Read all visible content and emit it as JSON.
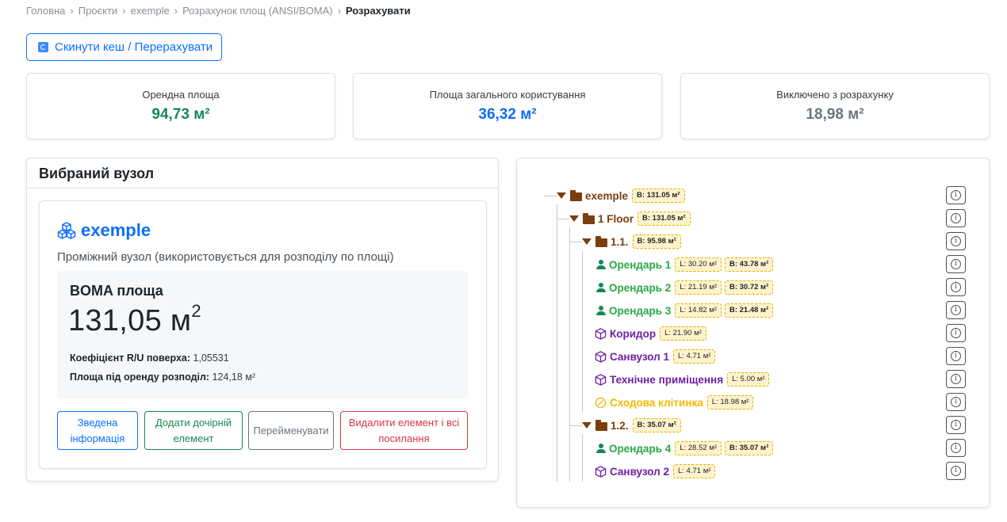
{
  "breadcrumb": {
    "items": [
      "Головна",
      "Проєкти",
      "exemple",
      "Розрахунок площ (ANSI/BOMA)"
    ],
    "current": "Розрахувати",
    "separator": "›"
  },
  "toolbar": {
    "reset_label": "Скинути кеш / Перерахувати"
  },
  "stats": [
    {
      "label": "Орендна площа",
      "value": "94,73 м²",
      "color": "#198754"
    },
    {
      "label": "Площа загального користування",
      "value": "36,32 м²",
      "color": "#0d6efd"
    },
    {
      "label": "Виключено з розрахунку",
      "value": "18,98 м²",
      "color": "#6c757d"
    }
  ],
  "selected": {
    "header": "Вибраний вузол",
    "node_name": "exemple",
    "node_desc": "Проміжний вузол (використовується для розподілу по площі)",
    "boma_title": "BOMA площа",
    "boma_value": "131,05 м",
    "boma_unit_sup": "2",
    "ru_label": "Коефіцієнт R/U поверха:",
    "ru_value": "1,05531",
    "rent_label": "Площа під оренду розподіл:",
    "rent_value": "124,18 м²",
    "buttons": {
      "info": "Зведена інформація",
      "add_child": "Додати дочірній елемент",
      "rename": "Перейменувати",
      "delete": "Видалити елемент і всі посилання"
    }
  },
  "tree": [
    {
      "kind": "folder",
      "label": "exemple",
      "color": "#7a3e0e",
      "tags": [
        "B: 131.05 м²"
      ]
    },
    {
      "kind": "folder",
      "label": "1 Floor",
      "color": "#7a3e0e",
      "tags": [
        "B: 131.05 м²"
      ]
    },
    {
      "kind": "folder",
      "label": "1.1.",
      "color": "#7a3e0e",
      "tags": [
        "B: 95.98 м²"
      ]
    },
    {
      "kind": "tenant",
      "label": "Орендарь 1",
      "color": "#28a745",
      "tags": [
        "L: 30.20 м²",
        "B: 43.78 м²"
      ]
    },
    {
      "kind": "tenant",
      "label": "Орендарь 2",
      "color": "#28a745",
      "tags": [
        "L: 21.19 м²",
        "B: 30.72 м²"
      ]
    },
    {
      "kind": "tenant",
      "label": "Орендарь 3",
      "color": "#28a745",
      "tags": [
        "L: 14.82 м²",
        "B: 21.48 м²"
      ]
    },
    {
      "kind": "common",
      "label": "Коридор",
      "color": "#6f1fa3",
      "tags": [
        "L: 21.90 м²"
      ]
    },
    {
      "kind": "common",
      "label": "Санвузол 1",
      "color": "#6f1fa3",
      "tags": [
        "L: 4.71 м²"
      ]
    },
    {
      "kind": "common",
      "label": "Технічне приміщення",
      "color": "#6f1fa3",
      "tags": [
        "L: 5.00 м²"
      ]
    },
    {
      "kind": "excluded",
      "label": "Сходова клітинка",
      "color": "#f5b800",
      "tags": [
        "L: 18.98 м²"
      ]
    },
    {
      "kind": "folder",
      "label": "1.2.",
      "color": "#7a3e0e",
      "tags": [
        "B: 35.07 м²"
      ]
    },
    {
      "kind": "tenant",
      "label": "Орендарь 4",
      "color": "#28a745",
      "tags": [
        "L: 28.52 м²",
        "B: 35.07 м²"
      ]
    },
    {
      "kind": "common",
      "label": "Санвузол 2",
      "color": "#6f1fa3",
      "tags": [
        "L: 4.71 м²"
      ]
    }
  ]
}
